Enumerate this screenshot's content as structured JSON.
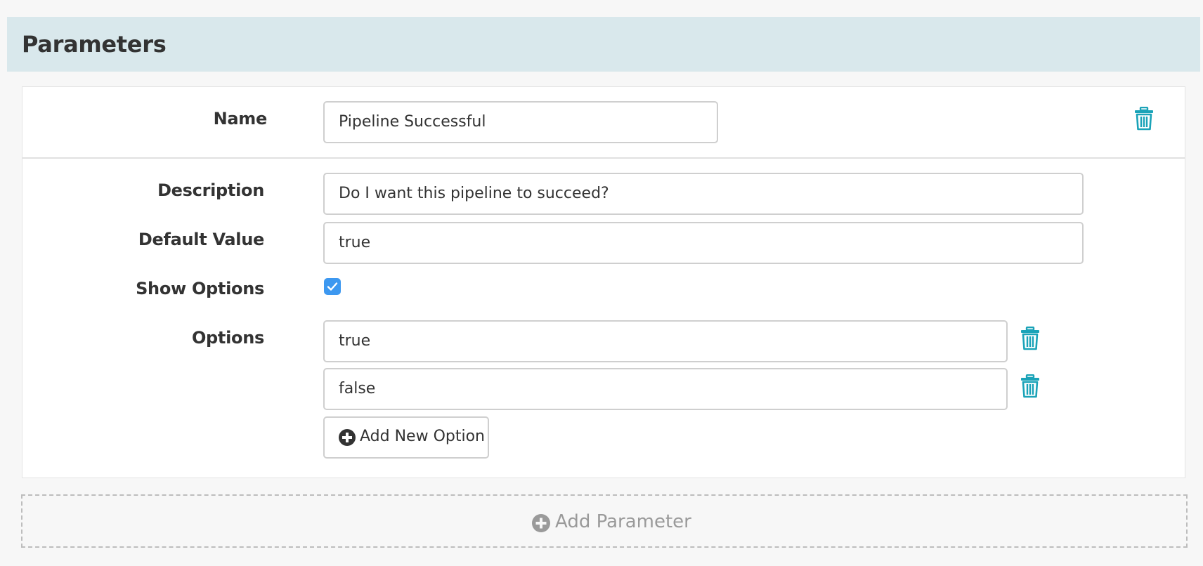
{
  "section": {
    "title": "Parameters"
  },
  "parameter": {
    "name_label": "Name",
    "name_value": "Pipeline Successful",
    "description_label": "Description",
    "description_value": "Do I want this pipeline to succeed?",
    "default_label": "Default Value",
    "default_value": "true",
    "show_options_label": "Show Options",
    "show_options_checked": true,
    "options_label": "Options",
    "options": [
      "true",
      "false"
    ],
    "add_option_label": "Add New Option"
  },
  "footer": {
    "add_parameter_label": "Add Parameter"
  },
  "icons": {
    "trash": "trash-icon",
    "plus_circle": "plus-circle-icon",
    "check": "check-icon"
  },
  "colors": {
    "header_bg": "#d9e8ec",
    "accent_teal": "#1aa3b8",
    "checkbox_blue": "#3d98f0",
    "muted_text": "#9a9a9a"
  }
}
